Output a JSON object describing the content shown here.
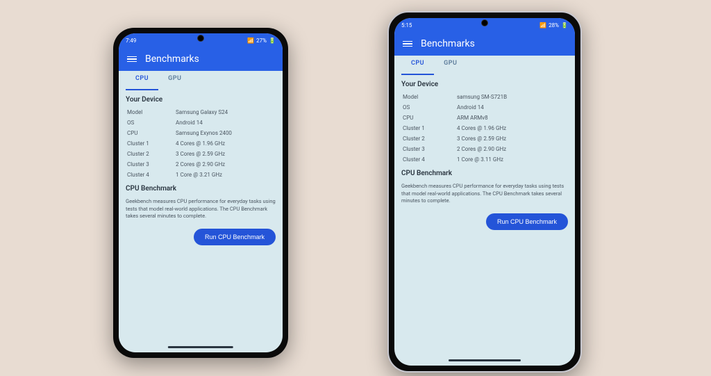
{
  "devices": [
    {
      "status": {
        "time": "7:49",
        "battery": "27%"
      },
      "app_title": "Benchmarks",
      "tabs": {
        "cpu": "CPU",
        "gpu": "GPU"
      },
      "section_device": "Your Device",
      "specs": [
        {
          "label": "Model",
          "value": "Samsung Galaxy S24"
        },
        {
          "label": "OS",
          "value": "Android 14"
        },
        {
          "label": "CPU",
          "value": "Samsung Exynos 2400"
        },
        {
          "label": "Cluster 1",
          "value": "4 Cores @ 1.96 GHz"
        },
        {
          "label": "Cluster 2",
          "value": "3 Cores @ 2.59 GHz"
        },
        {
          "label": "Cluster 3",
          "value": "2 Cores @ 2.90 GHz"
        },
        {
          "label": "Cluster 4",
          "value": "1 Core @ 3.21 GHz"
        }
      ],
      "section_bench": "CPU Benchmark",
      "bench_desc": "Geekbench measures CPU performance for everyday tasks using tests that model real-world applications. The CPU Benchmark takes several minutes to complete.",
      "run_label": "Run CPU Benchmark"
    },
    {
      "status": {
        "time": "5:15",
        "battery": "28%"
      },
      "app_title": "Benchmarks",
      "tabs": {
        "cpu": "CPU",
        "gpu": "GPU"
      },
      "section_device": "Your Device",
      "specs": [
        {
          "label": "Model",
          "value": "samsung SM-S721B"
        },
        {
          "label": "OS",
          "value": "Android 14"
        },
        {
          "label": "CPU",
          "value": "ARM ARMv8"
        },
        {
          "label": "Cluster 1",
          "value": "4 Cores @ 1.96 GHz"
        },
        {
          "label": "Cluster 2",
          "value": "3 Cores @ 2.59 GHz"
        },
        {
          "label": "Cluster 3",
          "value": "2 Cores @ 2.90 GHz"
        },
        {
          "label": "Cluster 4",
          "value": "1 Core @ 3.11 GHz"
        }
      ],
      "section_bench": "CPU Benchmark",
      "bench_desc": "Geekbench measures CPU performance for everyday tasks using tests that model real-world applications. The CPU Benchmark takes several minutes to complete.",
      "run_label": "Run CPU Benchmark"
    }
  ]
}
